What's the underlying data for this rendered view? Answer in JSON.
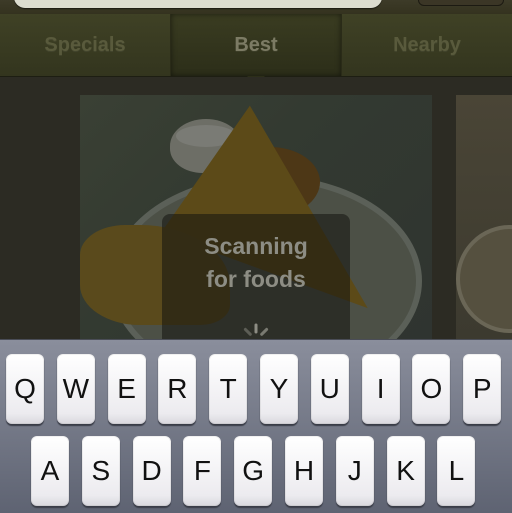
{
  "tabs": [
    {
      "label": "Specials",
      "active": false
    },
    {
      "label": "Best",
      "active": true
    },
    {
      "label": "Nearby",
      "active": false
    }
  ],
  "hud": {
    "line1": "Scanning",
    "line2": "for foods",
    "spinner_icon": "spinner-icon"
  },
  "keyboard": {
    "row1": [
      "Q",
      "W",
      "E",
      "R",
      "T",
      "Y",
      "U",
      "I",
      "O",
      "P"
    ],
    "row2": [
      "A",
      "S",
      "D",
      "F",
      "G",
      "H",
      "J",
      "K",
      "L"
    ]
  },
  "colors": {
    "tabbar": "#3f4125",
    "keyboard_bg": "#8a8e9c",
    "key": "#ffffff"
  }
}
